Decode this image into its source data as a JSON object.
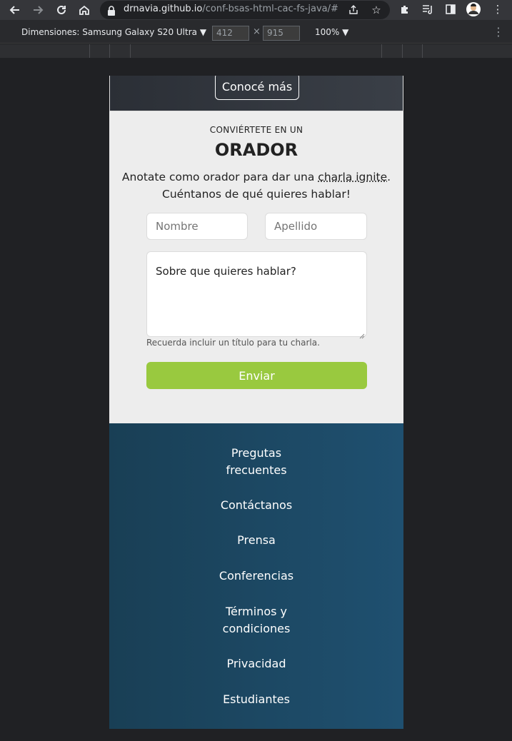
{
  "browser": {
    "url_host": "drnavia.github.io",
    "url_path": "/conf-bsas-html-cac-fs-java/#"
  },
  "devtools": {
    "device_label": "Dimensiones: Samsung Galaxy S20 Ultra",
    "width": "412",
    "height": "915",
    "separator": "×",
    "zoom": "100%"
  },
  "hero": {
    "cta_label": "Conocé más"
  },
  "speaker_form": {
    "eyebrow": "CONVIÉRTETE EN UN",
    "title": "ORADOR",
    "lead_part1": "Anotate como orador para dar una ",
    "lead_link": "charla ignite",
    "lead_part2": ".",
    "lead_line2": "Cuéntanos de qué quieres hablar!",
    "first_name_placeholder": "Nombre",
    "last_name_placeholder": "Apellido",
    "topic_placeholder": "Sobre que quieres hablar?",
    "hint": "Recuerda incluir un título para tu charla.",
    "submit_label": "Enviar"
  },
  "footer": {
    "links": [
      {
        "line1": "Pregutas",
        "line2": "frecuentes"
      },
      {
        "line1": "Contáctanos",
        "line2": ""
      },
      {
        "line1": "Prensa",
        "line2": ""
      },
      {
        "line1": "Conferencias",
        "line2": ""
      },
      {
        "line1": "Términos y",
        "line2": "condiciones"
      },
      {
        "line1": "Privacidad",
        "line2": ""
      },
      {
        "line1": "Estudiantes",
        "line2": ""
      }
    ]
  }
}
